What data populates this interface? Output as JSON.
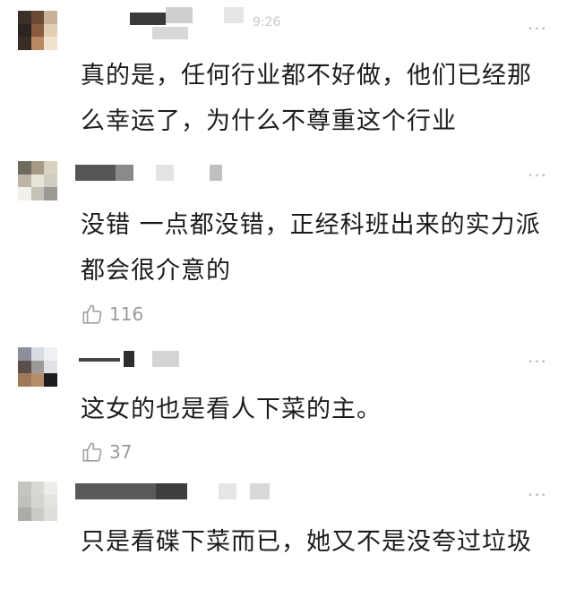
{
  "comments": [
    {
      "time": "9:26",
      "text": "真的是，任何行业都不好做，他们已经那么幸运了，为什么不尊重这个行业",
      "more": "···",
      "likes": null
    },
    {
      "time": "",
      "text": "没错 一点都没错，正经科班出来的实力派都会很介意的",
      "more": "···",
      "likes": "116"
    },
    {
      "time": "",
      "text": "这女的也是看人下菜的主。",
      "more": "···",
      "likes": "37"
    },
    {
      "time": "",
      "text": "只是看碟下菜而已，她又不是没夸过垃圾",
      "more": "···",
      "likes": null
    }
  ],
  "icons": {
    "like": "thumbs-up-icon",
    "more": "more-dots-icon"
  }
}
